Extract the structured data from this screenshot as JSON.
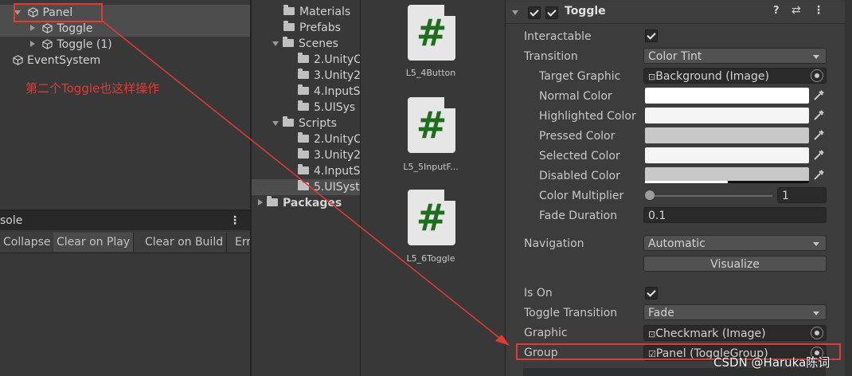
{
  "hierarchy": {
    "items": [
      {
        "label": "Panel"
      },
      {
        "label": "Toggle"
      },
      {
        "label": "Toggle (1)"
      },
      {
        "label": "EventSystem"
      }
    ]
  },
  "annotation": {
    "text": "第二个Toggle也这样操作",
    "color": "#e53935"
  },
  "console": {
    "tab": "sole",
    "buttons": [
      "Collapse",
      "Clear on Play",
      "Clear on Build",
      "Err"
    ]
  },
  "folders": {
    "items": [
      "Materials",
      "Prefabs",
      "Scenes",
      "2.UnityC",
      "3.Unity2",
      "4.InputS",
      "5.UISys",
      "Scripts",
      "2.UnityC",
      "3.Unity2",
      "4.InputS",
      "5.UISyst",
      "Packages"
    ]
  },
  "assets": {
    "files": [
      {
        "symbol": "#",
        "name": "L5_4Button"
      },
      {
        "symbol": "#",
        "name": "L5_5InputF..."
      },
      {
        "symbol": "#",
        "name": "L5_6Toggle"
      }
    ]
  },
  "inspector": {
    "component_title": "Toggle",
    "interactable_label": "Interactable",
    "transition_label": "Transition",
    "transition_value": "Color Tint",
    "target_graphic_label": "Target Graphic",
    "target_graphic_value": "Background (Image)",
    "normal_color_label": "Normal Color",
    "highlighted_color_label": "Highlighted Color",
    "pressed_color_label": "Pressed Color",
    "selected_color_label": "Selected Color",
    "disabled_color_label": "Disabled Color",
    "color_multiplier_label": "Color Multiplier",
    "color_multiplier_value": "1",
    "fade_duration_label": "Fade Duration",
    "fade_duration_value": "0.1",
    "navigation_label": "Navigation",
    "navigation_value": "Automatic",
    "visualize_label": "Visualize",
    "is_on_label": "Is On",
    "toggle_transition_label": "Toggle Transition",
    "toggle_transition_value": "Fade",
    "graphic_label": "Graphic",
    "graphic_value": "Checkmark (Image)",
    "group_label": "Group",
    "group_value": "Panel (ToggleGroup)",
    "colors": {
      "normal": "#ffffff",
      "highlighted": "#f5f5f5",
      "pressed": "#c8c8c8",
      "selected": "#f5f5f5",
      "disabled": "#c8c8c8"
    }
  },
  "watermark": "CSDN @Haruka陈词"
}
